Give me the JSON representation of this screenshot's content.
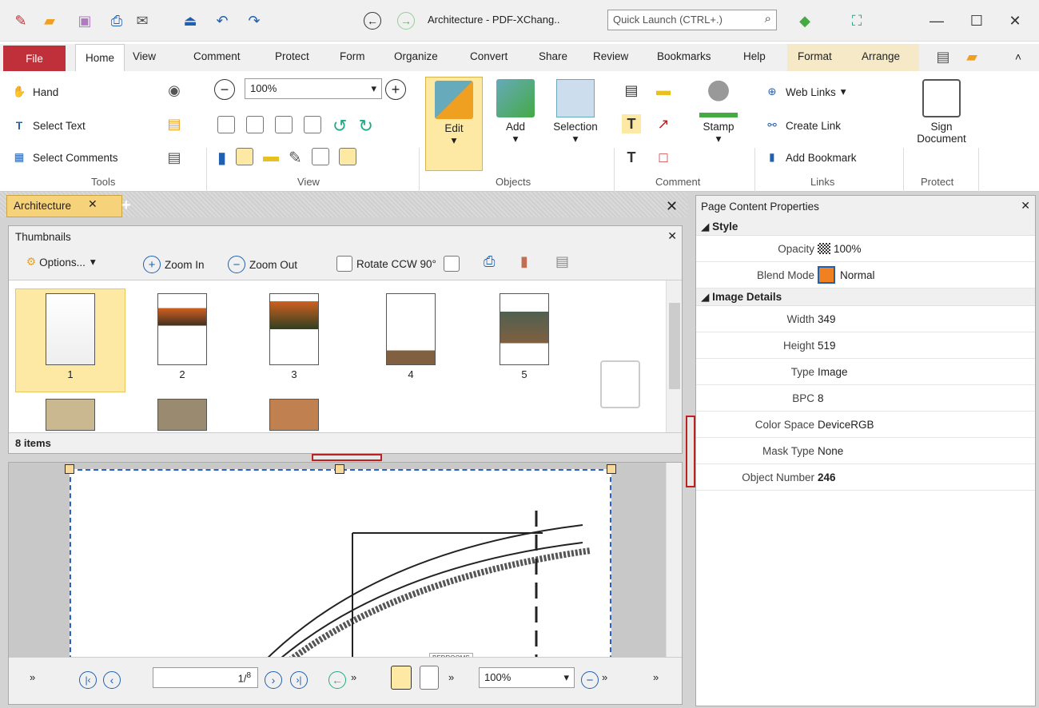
{
  "window": {
    "title": "Architecture - PDF-XChang..",
    "quick_launch_placeholder": "Quick Launch (CTRL+.)"
  },
  "menu": {
    "file": "File",
    "home": "Home",
    "items": [
      "View",
      "Comment",
      "Protect",
      "Form",
      "Organize",
      "Convert",
      "Share",
      "Review",
      "Bookmarks",
      "Help"
    ],
    "context": [
      "Format",
      "Arrange"
    ]
  },
  "ribbon": {
    "tools": {
      "hand": "Hand",
      "select_text": "Select Text",
      "select_comments": "Select Comments",
      "label": "Tools"
    },
    "view": {
      "zoom": "100%",
      "label": "View"
    },
    "objects": {
      "edit": "Edit",
      "add": "Add",
      "selection": "Selection",
      "label": "Objects"
    },
    "comment": {
      "stamp": "Stamp",
      "label": "Comment"
    },
    "links": {
      "web_links": "Web Links",
      "create_link": "Create Link",
      "add_bookmark": "Add Bookmark",
      "label": "Links"
    },
    "protect": {
      "sign_line1": "Sign",
      "sign_line2": "Document",
      "label": "Protect"
    }
  },
  "doc_tab": {
    "name": "Architecture"
  },
  "thumbnails": {
    "title": "Thumbnails",
    "options": "Options...",
    "zoom_in": "Zoom In",
    "zoom_out": "Zoom Out",
    "rotate": "Rotate CCW 90°",
    "pages": [
      "1",
      "2",
      "3",
      "4",
      "5"
    ],
    "status": "8 items"
  },
  "viewer": {
    "page_value": "1/",
    "page_total": "8",
    "zoom": "100%",
    "drawing_label": "BEDROOMS"
  },
  "properties": {
    "title": "Page Content Properties",
    "section_style": "Style",
    "opacity_label": "Opacity",
    "opacity_value": "100%",
    "blend_label": "Blend Mode",
    "blend_value": "Normal",
    "section_image": "Image Details",
    "width_label": "Width",
    "width_value": "349",
    "height_label": "Height",
    "height_value": "519",
    "type_label": "Type",
    "type_value": "Image",
    "bpc_label": "BPC",
    "bpc_value": "8",
    "colorspace_label": "Color Space",
    "colorspace_value": "DeviceRGB",
    "masktype_label": "Mask Type",
    "masktype_value": "None",
    "objnum_label": "Object Number",
    "objnum_value": "246"
  },
  "colors": {
    "accent": "#c0303a",
    "selection": "#fde9a4",
    "tab": "#f6d27a",
    "highlight_border": "#c02020"
  }
}
